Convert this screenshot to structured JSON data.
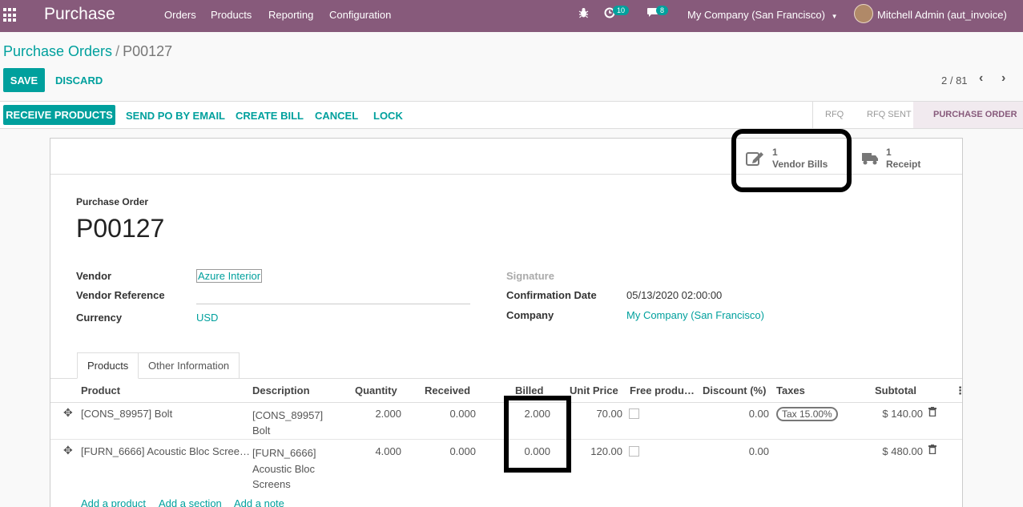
{
  "navbar": {
    "app_name": "Purchase",
    "menus": [
      "Orders",
      "Products",
      "Reporting",
      "Configuration"
    ],
    "activity_count": "10",
    "message_count": "8",
    "company": "My Company (San Francisco)",
    "user": "Mitchell Admin (aut_invoice)"
  },
  "breadcrumb": {
    "parent": "Purchase Orders",
    "separator": "/",
    "current": "P00127"
  },
  "controls": {
    "save": "SAVE",
    "discard": "DISCARD",
    "pager": "2 / 81"
  },
  "actions": [
    "RECEIVE PRODUCTS",
    "SEND PO BY EMAIL",
    "CREATE BILL",
    "CANCEL",
    "LOCK"
  ],
  "stages": [
    "RFQ",
    "RFQ SENT",
    "PURCHASE ORDER"
  ],
  "smart_buttons": {
    "bills_count": "1",
    "bills_label": "Vendor Bills",
    "receipt_count": "1",
    "receipt_label": "Receipt"
  },
  "form": {
    "subtitle": "Purchase Order",
    "name": "P00127",
    "vendor_label": "Vendor",
    "vendor": "Azure Interior",
    "vendor_ref_label": "Vendor Reference",
    "currency_label": "Currency",
    "currency": "USD",
    "signature_label": "Signature",
    "confirmation_label": "Confirmation Date",
    "confirmation": "05/13/2020 02:00:00",
    "company_label": "Company",
    "company": "My Company (San Francisco)"
  },
  "tabs": [
    "Products",
    "Other Information"
  ],
  "table": {
    "headers": [
      "Product",
      "Description",
      "Quantity",
      "Received",
      "Billed",
      "Unit Price",
      "Free produ…",
      "Discount (%)",
      "Taxes",
      "Subtotal"
    ],
    "rows": [
      {
        "product": "[CONS_89957] Bolt",
        "desc1": "[CONS_89957]",
        "desc2": "Bolt",
        "desc3": "",
        "qty": "2.000",
        "received": "0.000",
        "billed": "2.000",
        "price": "70.00",
        "discount": "0.00",
        "tax": "Tax 15.00%",
        "subtotal": "$ 140.00"
      },
      {
        "product": "[FURN_6666] Acoustic Bloc Scree…",
        "desc1": "[FURN_6666]",
        "desc2": "Acoustic Bloc",
        "desc3": "Screens",
        "qty": "4.000",
        "received": "0.000",
        "billed": "0.000",
        "price": "120.00",
        "discount": "0.00",
        "tax": "",
        "subtotal": "$ 480.00"
      }
    ],
    "add_links": [
      "Add a product",
      "Add a section",
      "Add a note"
    ]
  }
}
